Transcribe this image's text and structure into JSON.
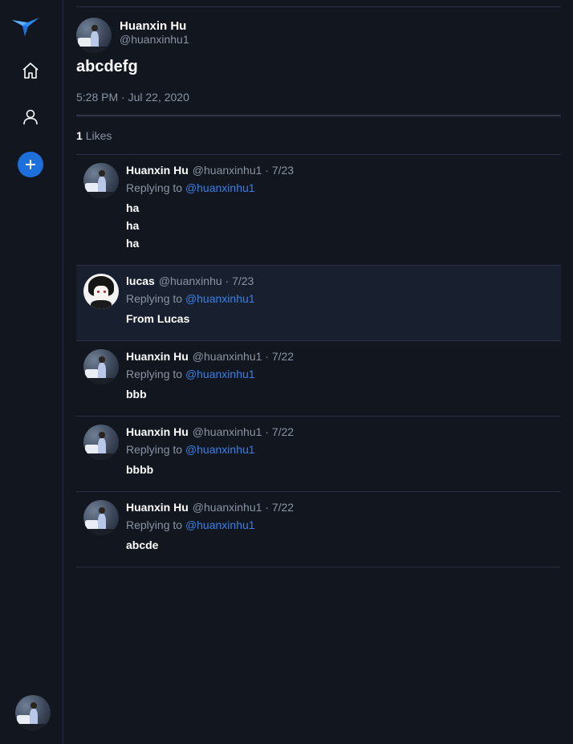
{
  "sidebar": {
    "logo_icon": "bird-logo-icon",
    "nav": [
      {
        "name": "home",
        "icon": "home-icon"
      },
      {
        "name": "profile",
        "icon": "user-icon"
      }
    ],
    "compose_icon": "plus-icon",
    "accent_color": "#1d6fdc"
  },
  "post": {
    "author_name": "Huanxin Hu",
    "author_handle": "@huanxinhu1",
    "text": "abcdefg",
    "timestamp": "5:28 PM · Jul 22, 2020",
    "likes_count": "1",
    "likes_label": "Likes"
  },
  "replies": [
    {
      "name": "Huanxin Hu",
      "meta": "@huanxinhu1 · 7/23",
      "replying_label": "Replying to",
      "replying_handle": "@huanxinhu1",
      "lines": [
        "ha",
        "ha",
        "ha"
      ],
      "avatar": "user"
    },
    {
      "name": "lucas",
      "meta": "@huanxinhu · 7/23",
      "replying_label": "Replying to",
      "replying_handle": "@huanxinhu1",
      "lines": [
        "From Lucas"
      ],
      "avatar": "lucas"
    },
    {
      "name": "Huanxin Hu",
      "meta": "@huanxinhu1 · 7/22",
      "replying_label": "Replying to",
      "replying_handle": "@huanxinhu1",
      "lines": [
        "bbb"
      ],
      "avatar": "user"
    },
    {
      "name": "Huanxin Hu",
      "meta": "@huanxinhu1 · 7/22",
      "replying_label": "Replying to",
      "replying_handle": "@huanxinhu1",
      "lines": [
        "bbbb"
      ],
      "avatar": "user"
    },
    {
      "name": "Huanxin Hu",
      "meta": "@huanxinhu1 · 7/22",
      "replying_label": "Replying to",
      "replying_handle": "@huanxinhu1",
      "lines": [
        "abcde"
      ],
      "avatar": "user"
    }
  ],
  "colors": {
    "background": "#11161f",
    "link": "#3d7fe0",
    "muted_text": "#8b94a3",
    "highlight_row": "#182030"
  }
}
